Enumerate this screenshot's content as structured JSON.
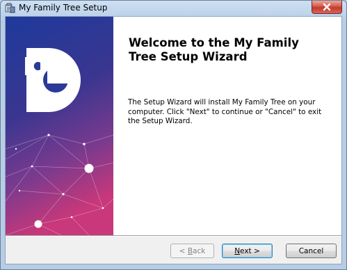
{
  "window": {
    "title": "My Family Tree Setup"
  },
  "title_bar": {
    "app_icon": "setup-icon",
    "close_icon": "close-icon"
  },
  "banner": {
    "logo_icon": "family-tree-puzzle-logo-icon",
    "colors": [
      "#1f3a9a",
      "#6a3a92",
      "#c2357a"
    ]
  },
  "welcome": {
    "heading": "Welcome to the My Family Tree Setup Wizard",
    "body": "The Setup Wizard will install My Family Tree on your computer.  Click \"Next\" to continue or \"Cancel\" to exit the Setup Wizard."
  },
  "buttons": {
    "back": {
      "prefix": "< ",
      "accel": "B",
      "rest": "ack",
      "enabled": false
    },
    "next": {
      "prefix": "",
      "accel": "N",
      "rest": "ext >",
      "enabled": true
    },
    "cancel": {
      "label": "Cancel",
      "enabled": true
    }
  }
}
